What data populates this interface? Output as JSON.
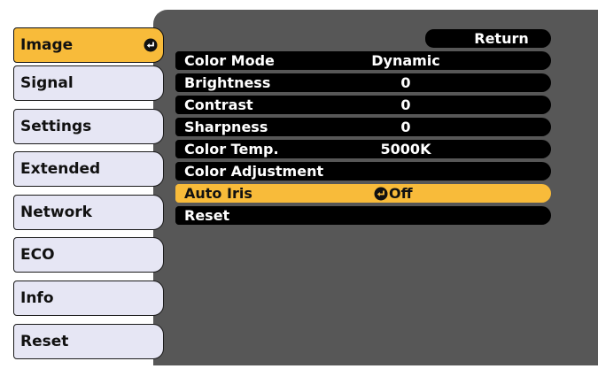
{
  "tabs": [
    {
      "label": "Image",
      "active": true
    },
    {
      "label": "Signal",
      "active": false
    },
    {
      "label": "Settings",
      "active": false
    },
    {
      "label": "Extended",
      "active": false
    },
    {
      "label": "Network",
      "active": false
    },
    {
      "label": "ECO",
      "active": false
    },
    {
      "label": "Info",
      "active": false
    },
    {
      "label": "Reset",
      "active": false
    }
  ],
  "return_label": "Return",
  "rows": [
    {
      "label": "Color Mode",
      "value": "Dynamic"
    },
    {
      "label": "Brightness",
      "value": "0"
    },
    {
      "label": "Contrast",
      "value": "0"
    },
    {
      "label": "Sharpness",
      "value": "0"
    },
    {
      "label": "Color Temp.",
      "value": "5000K"
    },
    {
      "label": "Color Adjustment",
      "value": ""
    },
    {
      "label": "Auto Iris",
      "value": "Off",
      "selected": true
    },
    {
      "label": "Reset",
      "value": ""
    }
  ],
  "colors": {
    "accent": "#f8bb3a",
    "panel": "#575757",
    "tab": "#e6e6f4",
    "row": "#000000"
  }
}
